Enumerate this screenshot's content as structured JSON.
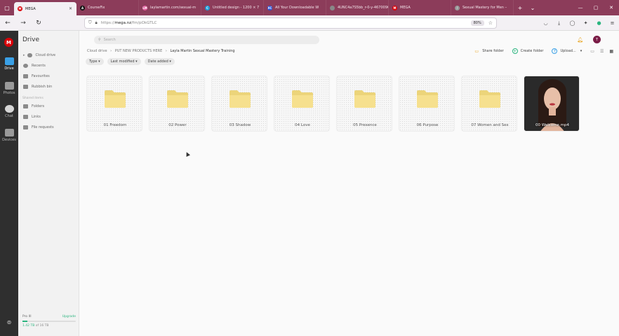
{
  "browser": {
    "tabs": [
      {
        "label": "MEGA",
        "active": true,
        "color": "#d90007",
        "glyph": "M"
      },
      {
        "label": "CourseFix",
        "active": false,
        "color": "#111111",
        "glyph": "A"
      },
      {
        "label": "laylamartin.com/sexual-m",
        "active": false,
        "color": "#e05a9b",
        "glyph": "LM"
      },
      {
        "label": "Untitled design - 1200 × 7",
        "active": false,
        "color": "#1e9bd7",
        "glyph": "C"
      },
      {
        "label": "All Your Downloadable W",
        "active": false,
        "color": "#2550d8",
        "glyph": "XC"
      },
      {
        "label": "4UNC4a7S5bb_r-0-y-4670096",
        "active": false,
        "color": "#888888",
        "glyph": ""
      },
      {
        "label": "MEGA",
        "active": false,
        "color": "#d90007",
        "glyph": "M"
      },
      {
        "label": "Sexual Mastery for Men –",
        "active": false,
        "color": "#999999",
        "glyph": "/"
      }
    ],
    "url_prefix": "https://",
    "url_domain": "mega.nz",
    "url_path": "/fm/pOkGTLC",
    "zoom": "80%"
  },
  "rail": {
    "items": [
      {
        "label": "Drive",
        "active": true
      },
      {
        "label": "Photos",
        "active": false
      },
      {
        "label": "Chat",
        "active": false
      },
      {
        "label": "Devices",
        "active": false
      }
    ]
  },
  "sidebar": {
    "title": "Drive",
    "items": [
      {
        "label": "Cloud drive"
      },
      {
        "label": "Recents"
      },
      {
        "label": "Favourites"
      },
      {
        "label": "Rubbish bin"
      }
    ],
    "shared_section": "Shared items",
    "shared_items": [
      {
        "label": "Folders"
      },
      {
        "label": "Links"
      },
      {
        "label": "File requests"
      }
    ],
    "storage": {
      "plan": "Pro III",
      "upgrade": "Upgrade",
      "used": "1.42 TB",
      "total": "of 16 TB",
      "fraction": 0.09
    }
  },
  "main": {
    "search_placeholder": "Search",
    "avatar_initial": "T",
    "breadcrumb": [
      "Cloud drive",
      "PUT NEW PRODUCTS HERE",
      "Layla Martin Sexual Mastery Training"
    ],
    "actions": {
      "share": "Share folder",
      "create": "Create folder",
      "upload": "Upload..."
    },
    "filters": [
      "Type",
      "Last modified",
      "Date added"
    ],
    "items": [
      {
        "name": "01 Freedom",
        "kind": "folder"
      },
      {
        "name": "02 Power",
        "kind": "folder"
      },
      {
        "name": "03 Shadow",
        "kind": "folder"
      },
      {
        "name": "04 Love",
        "kind": "folder"
      },
      {
        "name": "05 Presence",
        "kind": "folder"
      },
      {
        "name": "06 Purpose",
        "kind": "folder"
      },
      {
        "name": "07 Women and Sex",
        "kind": "folder"
      },
      {
        "name": "00 Welcome.mp4",
        "kind": "video"
      }
    ]
  },
  "colors": {
    "tabbar": "#8c3c5a",
    "mega_red": "#d90007",
    "accent_green": "#2bb57f",
    "folder_yellow": "#f6e08e"
  }
}
